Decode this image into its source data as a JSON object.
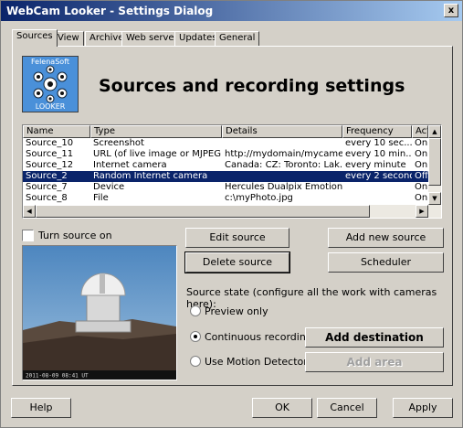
{
  "window": {
    "title": "WebCam Looker - Settings Dialog",
    "close_glyph": "x"
  },
  "tabs": [
    {
      "label": "Sources",
      "active": true
    },
    {
      "label": "View"
    },
    {
      "label": "Archive"
    },
    {
      "label": "Web server"
    },
    {
      "label": "Updates"
    },
    {
      "label": "General"
    }
  ],
  "logo": {
    "top_text": "FelenaSoft",
    "bottom_text": "LOOKER",
    "icon": "eyes-logo-icon"
  },
  "heading": "Sources and recording settings",
  "sources_table": {
    "columns": [
      "Name",
      "Type",
      "Details",
      "Frequency",
      "Acti"
    ],
    "rows": [
      [
        "Source_10",
        "Screenshot",
        "",
        "every 10 sec...",
        "On"
      ],
      [
        "Source_11",
        "URL (of live image or MJPEG ...",
        "http://mydomain/mycame...",
        "every 10 min...",
        "On"
      ],
      [
        "Source_12",
        "Internet camera",
        "Canada: CZ: Toronto: Lak...",
        "every minute",
        "On"
      ],
      [
        "Source_2",
        "Random Internet camera",
        "",
        "every 2 second",
        "Off"
      ],
      [
        "Source_7",
        "Device",
        "Hercules Dualpix Emotion",
        "",
        "On"
      ],
      [
        "Source_8",
        "File",
        "c:\\myPhoto.jpg",
        "",
        "On"
      ]
    ],
    "selected_row": 3,
    "scroll_up": "▲",
    "scroll_down": "▼",
    "scroll_left": "◀",
    "scroll_right": "▶"
  },
  "turn_source_on": {
    "label": "Turn source on",
    "checked": false
  },
  "buttons": {
    "edit_source": "Edit source",
    "add_new_source": "Add new source",
    "delete_source": "Delete source",
    "scheduler": "Scheduler",
    "add_destination": "Add destination",
    "add_area": "Add area"
  },
  "preview_caption": "2011-08-09 08:41 UT",
  "source_state": {
    "label": "Source state (configure all the work with cameras here):",
    "options": [
      {
        "label": "Preview only",
        "checked": false
      },
      {
        "label": "Continuous recording",
        "checked": true
      },
      {
        "label": "Use Motion Detector",
        "checked": false
      }
    ]
  },
  "dialog_buttons": {
    "help": "Help",
    "ok": "OK",
    "cancel": "Cancel",
    "apply": "Apply"
  }
}
